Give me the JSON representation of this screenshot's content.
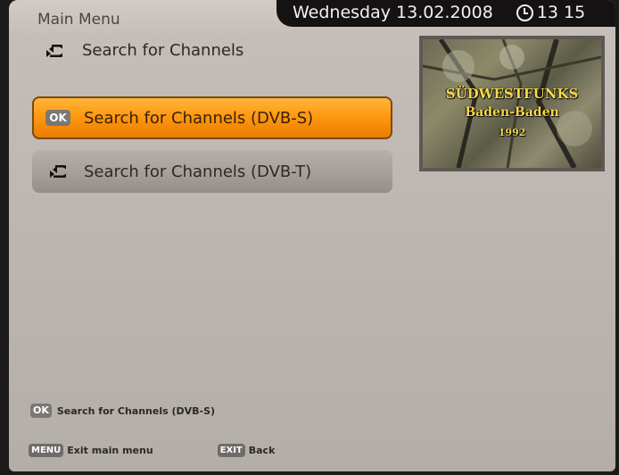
{
  "header": {
    "menu_title": "Main Menu",
    "date": "Wednesday 13.02.2008",
    "time": "13 15"
  },
  "breadcrumb": {
    "label": "Search for Channels",
    "icon": "arrow-icon"
  },
  "menu": {
    "items": [
      {
        "label": "Search for Channels (DVB-S)",
        "badge": "OK",
        "state": "selected"
      },
      {
        "label": "Search for Channels (DVB-T)",
        "icon": "arrow-icon",
        "state": "normal"
      }
    ]
  },
  "preview": {
    "lines": [
      "SÜDWESTFUNKS",
      "Baden-Baden",
      "1992"
    ]
  },
  "help": {
    "badge": "OK",
    "text": "Search for Channels (DVB-S)"
  },
  "footer": {
    "menu_key": "MENU",
    "menu_label": "Exit main menu",
    "exit_key": "EXIT",
    "exit_label": "Back"
  },
  "colors": {
    "accent": "#ff9a10",
    "background": "#c2bbb5",
    "topbar": "#141212"
  }
}
